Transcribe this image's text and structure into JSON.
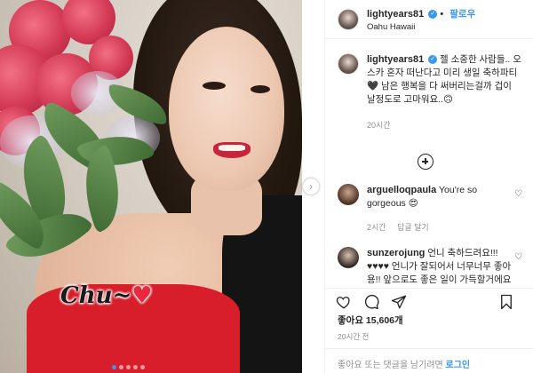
{
  "post": {
    "username": "lightyears81",
    "follow_label": "팔로우",
    "location": "Oahu Hawaii",
    "photo_overlay": {
      "text": "Chu~",
      "heart": "♥"
    },
    "carousel": {
      "count": 5,
      "active_index": 0,
      "next_icon": "chevron-right-icon"
    },
    "caption": {
      "username": "lightyears81",
      "text": "젤 소중한 사람들.. 오스카 혼자 떠난다고 미리 생일 축하파티🖤 남은 행복을 다 써버리는걸까 겁이 날정도로 고마워요..🙃",
      "time": "20시간"
    },
    "load_more_icon": "plus-circle-icon"
  },
  "comments": [
    {
      "username": "arguelloqpaula",
      "text": "You're so gorgeous 😍",
      "time": "2시간",
      "reply_label": "답글 달기"
    },
    {
      "username": "sunzerojung",
      "text": "언니 축하드려요!!! ♥♥♥♥ 언니가 잘되어서 너무너무 좋아용!! 앞으로도 좋은 일이 가득할거에요"
    }
  ],
  "actions": {
    "icons": [
      "heart-icon",
      "comment-icon",
      "share-icon",
      "bookmark-icon"
    ],
    "likes_label": "좋아요 15,606개",
    "post_time": "20시간 전"
  },
  "footer": {
    "prefix": "좋아요 또는 댓글을 남기려면",
    "login_label": "로그인"
  },
  "colors": {
    "accent": "#3897f0",
    "text": "#262626",
    "muted": "#8e8e8e",
    "border": "#efefef"
  }
}
